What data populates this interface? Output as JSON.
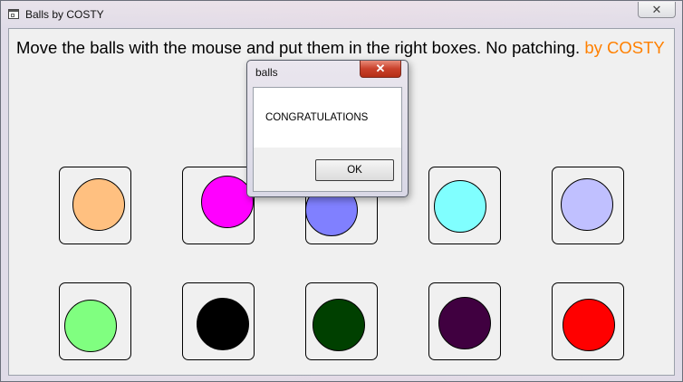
{
  "window": {
    "title": "Balls by COSTY",
    "close_glyph": "✕"
  },
  "instructions": {
    "text": "Move the balls with the mouse and put them in the right boxes. No patching.",
    "author": "by COSTY",
    "author_color": "#ff8000"
  },
  "balls": [
    {
      "name": "orange",
      "color": "#ffc080"
    },
    {
      "name": "magenta",
      "color": "#ff00ff"
    },
    {
      "name": "periwinkle",
      "color": "#8080ff"
    },
    {
      "name": "cyan",
      "color": "#80ffff"
    },
    {
      "name": "lavender",
      "color": "#c0c0ff"
    },
    {
      "name": "light-green",
      "color": "#80ff80"
    },
    {
      "name": "black",
      "color": "#000000"
    },
    {
      "name": "dark-green",
      "color": "#004000"
    },
    {
      "name": "dark-purple",
      "color": "#400040"
    },
    {
      "name": "red",
      "color": "#ff0000"
    }
  ],
  "dialog": {
    "title": "balls",
    "close_glyph": "✕",
    "message": "CONGRATULATIONS",
    "ok_label": "OK"
  }
}
